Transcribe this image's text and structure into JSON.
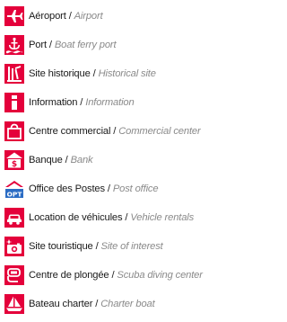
{
  "legend": {
    "items": [
      {
        "icon": "airplane-icon",
        "fr": "Aéroport",
        "en": "Airport"
      },
      {
        "icon": "ferry-port-icon",
        "fr": "Port",
        "en": "Boat ferry port"
      },
      {
        "icon": "historical-site-icon",
        "fr": "Site historique",
        "en": "Historical site"
      },
      {
        "icon": "information-icon",
        "fr": "Information",
        "en": "Information"
      },
      {
        "icon": "shopping-bag-icon",
        "fr": "Centre commercial",
        "en": "Commercial center"
      },
      {
        "icon": "bank-icon",
        "fr": "Banque",
        "en": "Bank"
      },
      {
        "icon": "post-office-icon",
        "fr": "Office des Postes",
        "en": "Post office"
      },
      {
        "icon": "car-rental-icon",
        "fr": "Location de véhicules",
        "en": "Vehicle rentals"
      },
      {
        "icon": "camera-icon",
        "fr": "Site touristique",
        "en": "Site of interest"
      },
      {
        "icon": "diving-icon",
        "fr": "Centre de plongée",
        "en": "Scuba diving center"
      },
      {
        "icon": "sailboat-icon",
        "fr": "Bateau charter",
        "en": "Charter boat"
      }
    ],
    "separator": "/",
    "colors": {
      "icon_bg": "#e4003b",
      "french_text": "#1a1a1a",
      "english_text": "#8a8a8a",
      "post_blue": "#2b6cc4"
    }
  }
}
